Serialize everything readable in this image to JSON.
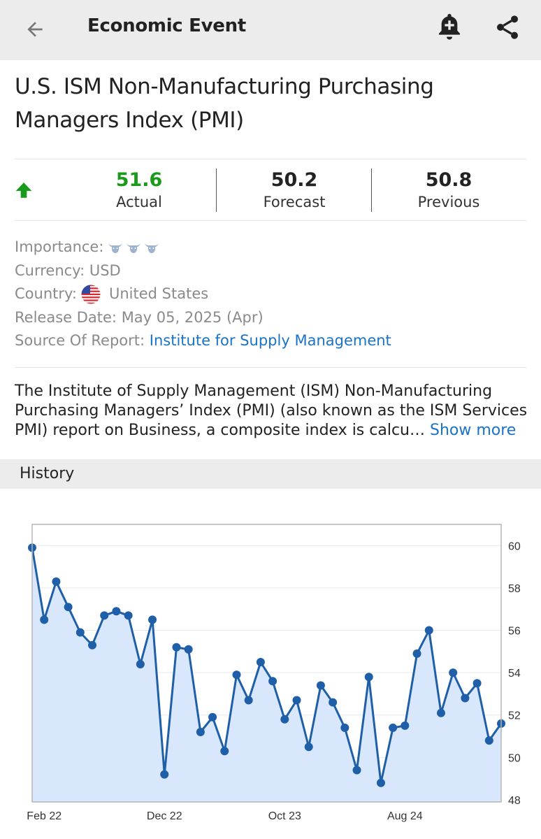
{
  "appbar": {
    "title": "Economic Event",
    "back_icon": "arrow-left-icon",
    "alert_icon": "bell-plus-icon",
    "share_icon": "share-icon"
  },
  "event": {
    "title": "U.S. ISM Non-Manufacturing Purchasing Managers Index (PMI)"
  },
  "stats": {
    "trend": "up",
    "actual": {
      "value": "51.6",
      "label": "Actual"
    },
    "forecast": {
      "value": "50.2",
      "label": "Forecast"
    },
    "previous": {
      "value": "50.8",
      "label": "Previous"
    }
  },
  "colors": {
    "positive": "#1a9a1a",
    "link": "#1a73c8",
    "line": "#1f5fa8",
    "area": "#d8e7fb"
  },
  "info": {
    "importance_label": "Importance:",
    "importance_level": 3,
    "currency_label": "Currency:",
    "currency_value": "USD",
    "country_label": "Country:",
    "country_value": "United States",
    "release_label": "Release Date:",
    "release_value": "May 05, 2025 (Apr)",
    "source_label": "Source Of Report:",
    "source_value": "Institute for Supply Management"
  },
  "description": {
    "text": "The Institute of Supply Management (ISM) Non-Manufacturing Purchasing Managers’ Index (PMI) (also known as the ISM Services PMI) report on Business, a composite index is calcu…",
    "show_more": "Show more"
  },
  "history": {
    "label": "History"
  },
  "chart_data": {
    "type": "area",
    "x": [
      "Jan 22",
      "Feb 22",
      "Mar 22",
      "Apr 22",
      "May 22",
      "Jun 22",
      "Jul 22",
      "Aug 22",
      "Sep 22",
      "Oct 22",
      "Nov 22",
      "Dec 22",
      "Jan 23",
      "Feb 23",
      "Mar 23",
      "Apr 23",
      "May 23",
      "Jun 23",
      "Jul 23",
      "Aug 23",
      "Sep 23",
      "Oct 23",
      "Nov 23",
      "Dec 23",
      "Jan 24",
      "Feb 24",
      "Mar 24",
      "Apr 24",
      "May 24",
      "Jun 24",
      "Jul 24",
      "Aug 24",
      "Sep 24",
      "Oct 24",
      "Nov 24",
      "Dec 24",
      "Jan 25",
      "Feb 25",
      "Mar 25",
      "Apr 25"
    ],
    "values": [
      59.9,
      56.5,
      58.3,
      57.1,
      55.9,
      55.3,
      56.7,
      56.9,
      56.7,
      54.4,
      56.5,
      49.2,
      55.2,
      55.1,
      51.2,
      51.9,
      50.3,
      53.9,
      52.7,
      54.5,
      53.6,
      51.8,
      52.7,
      50.5,
      53.4,
      52.6,
      51.4,
      49.4,
      53.8,
      48.8,
      51.4,
      51.5,
      54.9,
      56.0,
      52.1,
      54.0,
      52.8,
      53.5,
      50.8,
      51.6
    ],
    "xticks": [
      "Feb 22",
      "Dec 22",
      "Oct 23",
      "Aug 24"
    ],
    "yticks": [
      48,
      50,
      52,
      54,
      56,
      58,
      60
    ],
    "ylim": [
      47.9,
      61.0
    ],
    "grid": true,
    "y_axis_side": "right"
  }
}
